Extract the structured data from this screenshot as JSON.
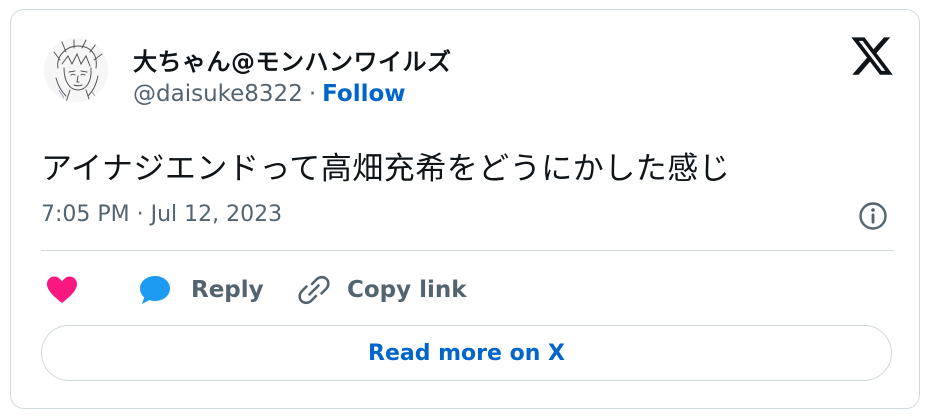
{
  "author": {
    "display_name": "大ちゃん@モンハンワイルズ",
    "handle": "@daisuke8322",
    "separator": "·",
    "follow_label": "Follow",
    "avatar_icon": "sketch-portrait-avatar"
  },
  "brand": {
    "logo_icon": "x-logo-icon"
  },
  "tweet": {
    "text": "アイナジエンドって高畑充希をどうにかした感じ",
    "timestamp": "7:05 PM · Jul 12, 2023"
  },
  "actions": {
    "like_icon": "heart-icon",
    "reply_icon": "speech-bubble-icon",
    "reply_label": "Reply",
    "copy_icon": "link-icon",
    "copy_label": "Copy link"
  },
  "footer": {
    "read_more_label": "Read more on X"
  },
  "colors": {
    "like": "#f91880",
    "reply": "#1d9bf0",
    "link_blue": "#0066cc",
    "muted": "#536471",
    "text": "#0f1419",
    "border": "#cfd9de"
  }
}
